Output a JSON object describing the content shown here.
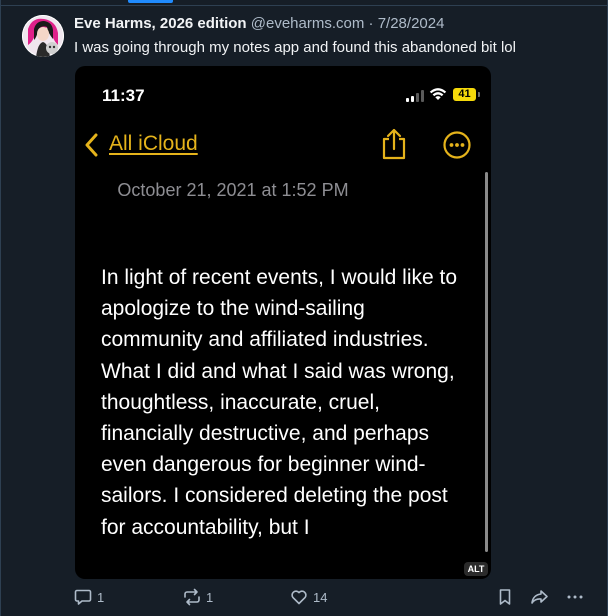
{
  "post": {
    "display_name": "Eve Harms, 2026 edition",
    "handle": "@eveharms.com",
    "separator": "·",
    "date": "7/28/2024",
    "text": "I was going through my notes app and found this abandoned bit lol"
  },
  "image": {
    "status_time": "11:37",
    "battery": "41",
    "back_label": "All iCloud",
    "note_date": "October 21, 2021 at 1:52 PM",
    "note_lines": [
      "In light of recent events, I would like to",
      "apologize to the wind-sailing",
      "community and affiliated industries.",
      "What I did and what I said was wrong,",
      "thoughtless, inaccurate, cruel,",
      "financially destructive, and perhaps",
      "even dangerous for beginner wind-",
      "sailors. I considered deleting the post",
      "for accountability, but I"
    ],
    "alt_badge": "ALT"
  },
  "actions": {
    "reply_count": "1",
    "repost_count": "1",
    "like_count": "14"
  },
  "icons": {
    "reply": "reply-icon",
    "repost": "repost-icon",
    "like": "heart-icon",
    "bookmark": "bookmark-icon",
    "share": "share-arrow-icon",
    "more": "more-dots-icon"
  },
  "colors": {
    "background": "#161e27",
    "accent_blue": "#208bfe",
    "notes_yellow": "#e5b31b",
    "muted_text": "#aebbc9"
  }
}
